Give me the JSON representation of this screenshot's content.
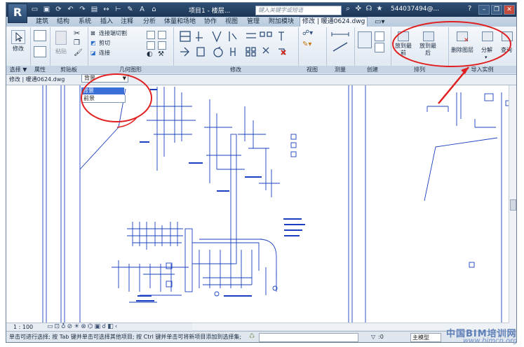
{
  "titlebar": {
    "app_logo": "R",
    "document_title": "项目1 - 楼层...",
    "search_placeholder": "键入关键字或短语",
    "user": "544037494@...",
    "help": "?"
  },
  "tabs": [
    "建筑",
    "结构",
    "系统",
    "插入",
    "注释",
    "分析",
    "体量和场地",
    "协作",
    "视图",
    "管理",
    "附加模块",
    "修改 | 暖通0624.dwg"
  ],
  "ribbon": {
    "groups": {
      "select": "选择",
      "properties": "属性",
      "clipboard": "剪贴板",
      "geometry": "几何图形",
      "modify": "修改",
      "view": "视图",
      "measure": "测量",
      "create": "创建",
      "arrange": "排列",
      "import_instance": "导入实例"
    },
    "buttons": {
      "modify": "修改",
      "paste": "粘贴",
      "cut_join": "连接端切割",
      "cut": "剪切",
      "join": "连接",
      "bring_front": "放到最前",
      "send_back": "放到最后",
      "delete_layers": "删除图层",
      "explode": "分解",
      "query": "查询"
    },
    "group_dropdown_marker": "▼"
  },
  "options_bar": {
    "context_label": "修改 | 暖通0624.dwg",
    "layer_select_value": "背景",
    "dropdown_options": [
      "背景",
      "前景"
    ]
  },
  "view_control": {
    "scale": "1 : 100"
  },
  "status": {
    "message": "单击可进行选择; 按 Tab 键并单击可选择其他项目; 按 Ctrl 键并单击可将新项目添加到选择集;",
    "filter_count": ":0",
    "model_label": "主模型"
  },
  "watermark": {
    "line1": "中国BIM培训网",
    "line2": "www.bimcn.org"
  },
  "colors": {
    "accent_red": "#e02020",
    "drawing_blue": "#1a3fbf",
    "selection_blue": "#3a6fd8"
  }
}
